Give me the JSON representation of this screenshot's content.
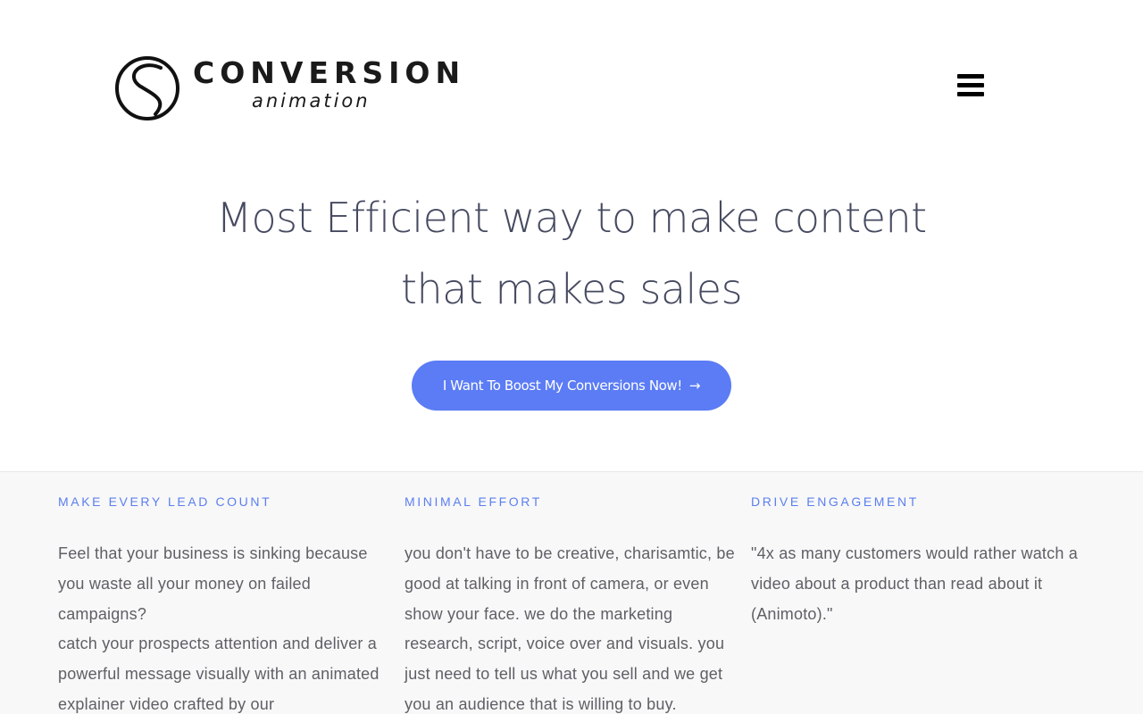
{
  "header": {
    "logo": {
      "wordmark": "CONVERSION",
      "subtitle": "animation"
    },
    "menu_icon": "hamburger-menu-icon"
  },
  "hero": {
    "title_line1": "Most Efficient way to make content",
    "title_line2": "that makes sales",
    "cta_label": "I Want To Boost My Conversions Now!",
    "cta_arrow": "→"
  },
  "features": [
    {
      "title": "MAKE EVERY LEAD COUNT",
      "paragraphs": [
        "Feel that your business is sinking because you waste all your money on failed campaigns?",
        "catch your prospects attention and deliver a powerful message visually with an animated explainer video crafted by our"
      ]
    },
    {
      "title": "MINIMAL EFFORT",
      "paragraphs": [
        "you don't have to be creative, charisamtic, be good at talking in front of camera, or even show your face. we do the marketing research, script, voice over and visuals. you just need to tell us what you sell and we get you an audience that is willing to buy."
      ]
    },
    {
      "title": "DRIVE ENGAGEMENT",
      "paragraphs": [
        "\"4x as many customers would rather watch a video about a product than read about it (Animoto).\""
      ]
    }
  ],
  "colors": {
    "accent": "#5b7cf5",
    "heading": "#464a60",
    "feature_title": "#5b7ff0",
    "body_text": "#5e6066",
    "feature_bg": "#f8f8f8"
  }
}
